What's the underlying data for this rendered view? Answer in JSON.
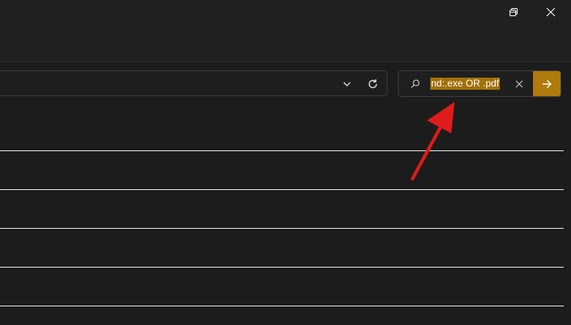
{
  "window_controls": {
    "minimize_icon": "minimize-icon",
    "restore_icon": "restore-icon",
    "close_icon": "close-icon"
  },
  "address_bar": {
    "chevron_icon": "chevron-down-icon",
    "refresh_icon": "refresh-icon"
  },
  "search": {
    "query": "nd:.exe OR .pdf",
    "highlight_color": "#a0700a",
    "search_icon": "search-icon",
    "clear_icon": "close-icon",
    "go_icon": "arrow-right-icon",
    "go_color": "#b07a0c"
  },
  "annotation": {
    "arrow_color": "#e01b1b"
  }
}
